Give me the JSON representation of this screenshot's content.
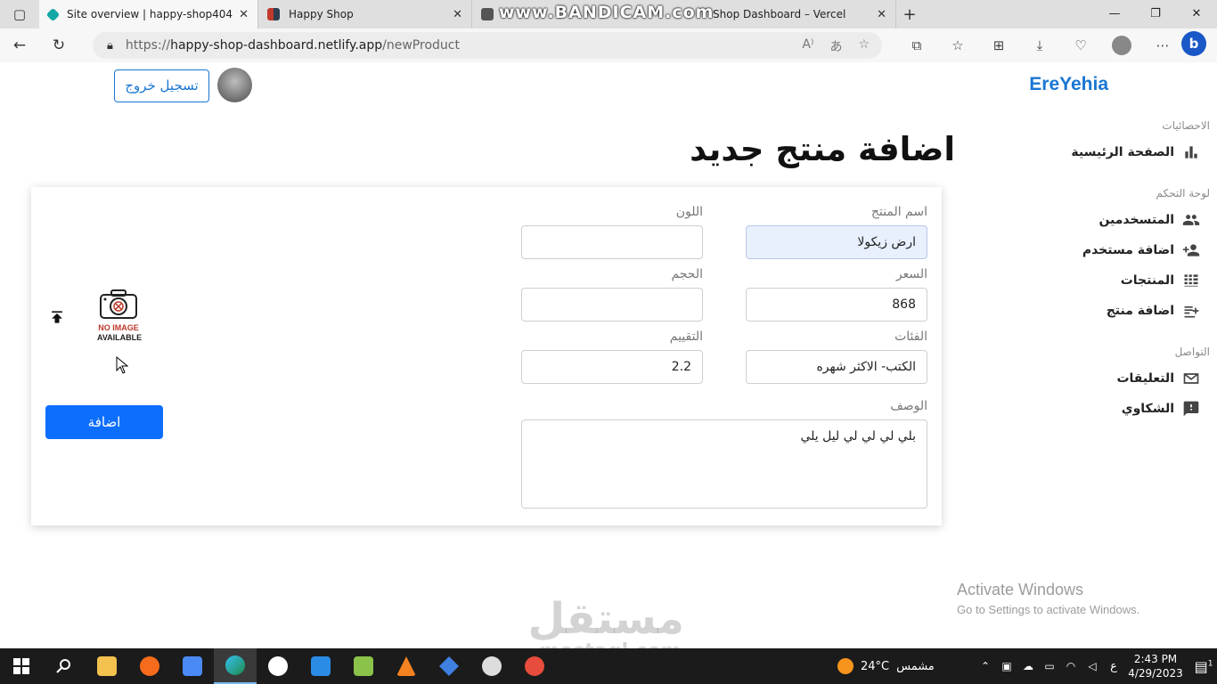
{
  "browser": {
    "tabs": [
      {
        "title": "Site overview | happy-shop404",
        "color": "#15a6a6"
      },
      {
        "title": "Happy Shop",
        "color": "#c0392b"
      },
      {
        "title": "Shop Dashboard – Vercel",
        "color": "#555555"
      }
    ],
    "url_scheme": "https://",
    "url_host": "happy-shop-dashboard.netlify.app",
    "url_path": "/newProduct",
    "recording_watermark": "www.BANDICAM.com"
  },
  "header": {
    "brand": "EreYehia",
    "logout_label": "تسجيل خروج"
  },
  "sidebar": {
    "sections": [
      {
        "title": "الاحصائيات",
        "items": [
          {
            "label": "الصفحة الرئيسية",
            "icon": "bar-chart-icon"
          }
        ]
      },
      {
        "title": "لوحة التحكم",
        "items": [
          {
            "label": "المتسخدمين",
            "icon": "users-icon"
          },
          {
            "label": "اضافة مستخدم",
            "icon": "add-user-icon"
          },
          {
            "label": "المنتجات",
            "icon": "grid-icon"
          },
          {
            "label": "اضافة منتج",
            "icon": "add-note-icon"
          }
        ]
      },
      {
        "title": "التواصل",
        "items": [
          {
            "label": "التعليقات",
            "icon": "mail-icon"
          },
          {
            "label": "الشكاوي",
            "icon": "feedback-icon"
          }
        ]
      }
    ]
  },
  "page": {
    "title": "اضافة منتج جديد"
  },
  "form": {
    "name_label": "اسم المنتج",
    "name_value": "ارض زيكولا",
    "color_label": "اللون",
    "color_value": "",
    "price_label": "السعر",
    "price_value": "868",
    "size_label": "الحجم",
    "size_value": "",
    "category_label": "الفئات",
    "category_value": "الكتب- الاكثر شهره",
    "rating_label": "التقييم",
    "rating_value": "2.2",
    "description_label": "الوصف",
    "description_value": "بلي لي لي لي ليل يلي",
    "no_image_line1": "NO IMAGE",
    "no_image_line2": "AVAILABLE",
    "submit_label": "اضافة"
  },
  "overlay": {
    "activate_title": "Activate Windows",
    "activate_sub": "Go to Settings to activate Windows.",
    "site_watermark_ar": "مستقل",
    "site_watermark_en": "mostaql.com"
  },
  "taskbar": {
    "weather_temp": "24°C",
    "weather_text": "مشمس",
    "lang": "ع",
    "time": "2:43 PM",
    "date": "4/29/2023",
    "notifications": "1"
  }
}
